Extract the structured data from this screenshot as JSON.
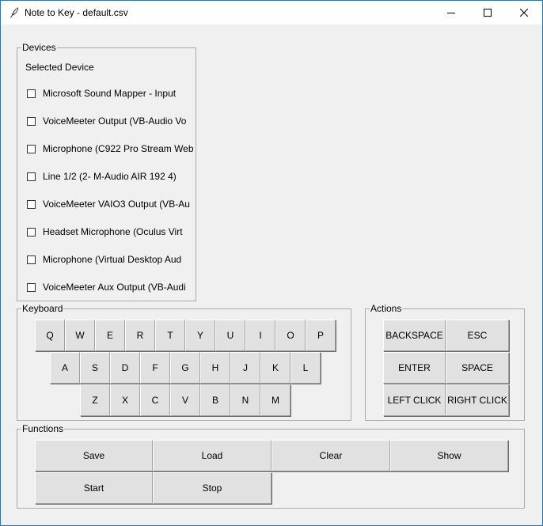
{
  "window": {
    "title": "Note to Key - default.csv"
  },
  "devices": {
    "legend": "Devices",
    "selected_label": "Selected Device",
    "items": [
      "Microsoft Sound Mapper - Input",
      "VoiceMeeter Output (VB-Audio Vo",
      "Microphone (C922 Pro Stream Web",
      "Line 1/2 (2- M-Audio AIR 192 4)",
      "VoiceMeeter VAIO3 Output (VB-Au",
      "Headset Microphone (Oculus Virt",
      "Microphone (Virtual Desktop Aud",
      "VoiceMeeter Aux Output (VB-Audi"
    ]
  },
  "keyboard": {
    "legend": "Keyboard",
    "rows": [
      [
        "Q",
        "W",
        "E",
        "R",
        "T",
        "Y",
        "U",
        "I",
        "O",
        "P"
      ],
      [
        "A",
        "S",
        "D",
        "F",
        "G",
        "H",
        "J",
        "K",
        "L"
      ],
      [
        "Z",
        "X",
        "C",
        "V",
        "B",
        "N",
        "M"
      ]
    ]
  },
  "actions": {
    "legend": "Actions",
    "buttons": [
      [
        "BACKSPACE",
        "ESC"
      ],
      [
        "ENTER",
        "SPACE"
      ],
      [
        "LEFT CLICK",
        "RIGHT CLICK"
      ]
    ]
  },
  "functions": {
    "legend": "Functions",
    "save": "Save",
    "load": "Load",
    "clear": "Clear",
    "show": "Show",
    "start": "Start",
    "stop": "Stop"
  }
}
